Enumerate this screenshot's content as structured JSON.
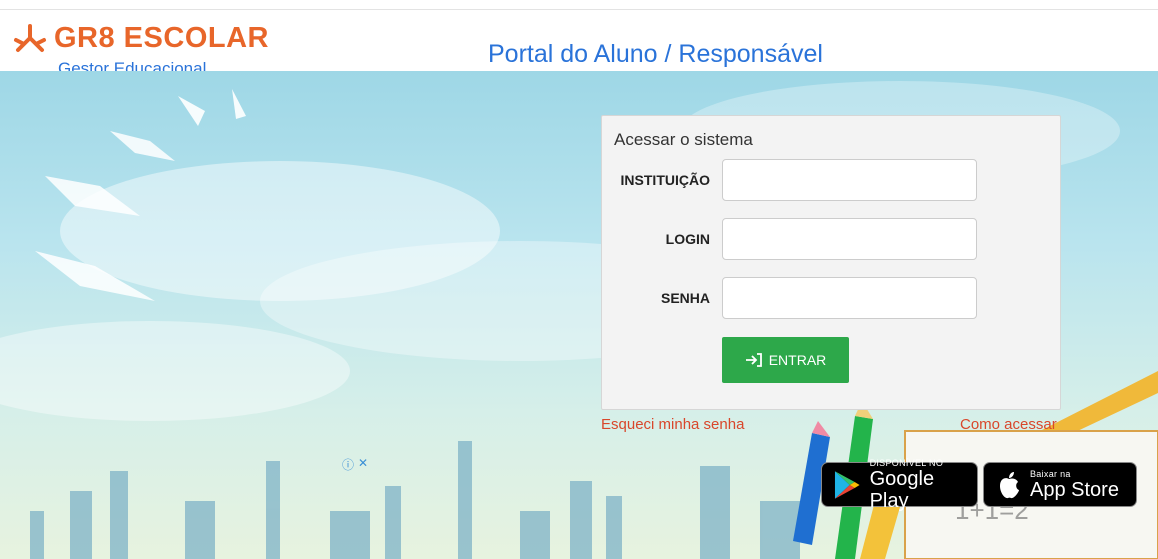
{
  "header": {
    "brand": "GR8 ESCOLAR",
    "tagline": "Gestor Educacional",
    "portal_title": "Portal do Aluno / Responsável"
  },
  "login": {
    "title": "Acessar o sistema",
    "institution_label": "INSTITUIÇÃO",
    "institution_value": "",
    "login_label": "LOGIN",
    "login_value": "",
    "password_label": "SENHA",
    "password_value": "",
    "submit_label": "ENTRAR"
  },
  "links": {
    "forgot_password": "Esqueci minha senha",
    "how_to_access": "Como acessar"
  },
  "stores": {
    "google_small": "DISPONÍVEL NO",
    "google_big": "Google Play",
    "apple_small": "Baixar na",
    "apple_big": "App Store"
  },
  "ad": {
    "info_glyph": "ⓘ",
    "close_glyph": "✕"
  },
  "colors": {
    "brand_orange": "#e8662a",
    "title_blue": "#2a73d9",
    "submit_green": "#2da84a",
    "link_red": "#d9472b"
  }
}
